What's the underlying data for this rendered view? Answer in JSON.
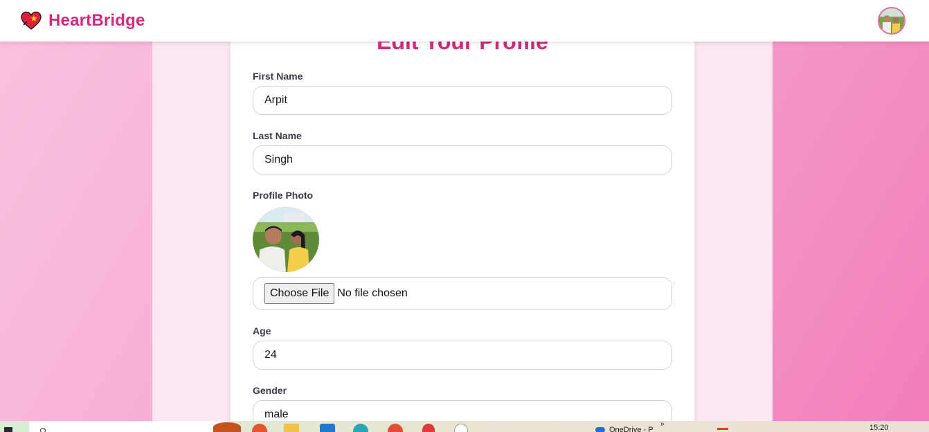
{
  "app": {
    "name": "HeartBridge"
  },
  "form": {
    "title": "Edit Your Profile",
    "first_name": {
      "label": "First Name",
      "value": "Arpit"
    },
    "last_name": {
      "label": "Last Name",
      "value": "Singh"
    },
    "profile_photo": {
      "label": "Profile Photo",
      "choose_label": "Choose File",
      "status": "No file chosen"
    },
    "age": {
      "label": "Age",
      "value": "24"
    },
    "gender": {
      "label": "Gender",
      "value": "male"
    }
  },
  "taskbar": {
    "onedrive": "OneDrive - P",
    "time": "15:20",
    "overflow": "»"
  },
  "colors": {
    "brand": "#d6287d",
    "page_bg": "#fce6f1",
    "accent_gradient_end": "#f27dbb"
  }
}
